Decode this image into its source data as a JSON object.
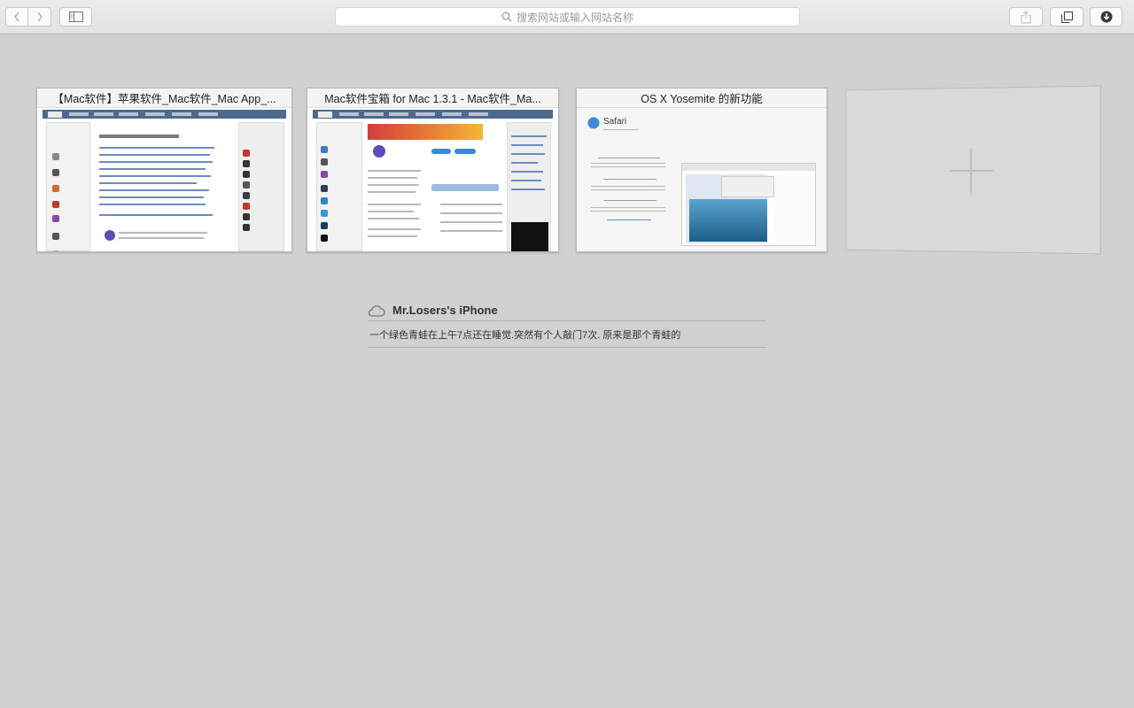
{
  "toolbar": {
    "back_icon": "chevron-left-icon",
    "forward_icon": "chevron-right-icon",
    "sidebar_icon": "sidebar-icon",
    "share_icon": "share-icon",
    "tabs_icon": "tab-overview-icon",
    "download_icon": "download-icon"
  },
  "address_bar": {
    "placeholder": "搜索网站或输入网站名称",
    "icon": "magnifier-icon"
  },
  "tabs": [
    {
      "title": "【Mac软件】苹果软件_Mac软件_Mac App_..."
    },
    {
      "title": "Mac软件宝箱 for Mac 1.3.1 - Mac软件_Ma..."
    },
    {
      "title": "OS X Yosemite 的新功能"
    }
  ],
  "tab3_page": {
    "app_name": "Safari"
  },
  "icloud_tabs": {
    "device_icon": "cloud-icon",
    "device_name": "Mr.Losers's iPhone",
    "items": [
      "一个绿色青蛙在上午7点还在睡觉.突然有个人敲门7次. 原来是那个青蛙的"
    ]
  },
  "colors": {
    "background": "#d1d1d1",
    "toolbar": "#e6e6e6"
  }
}
